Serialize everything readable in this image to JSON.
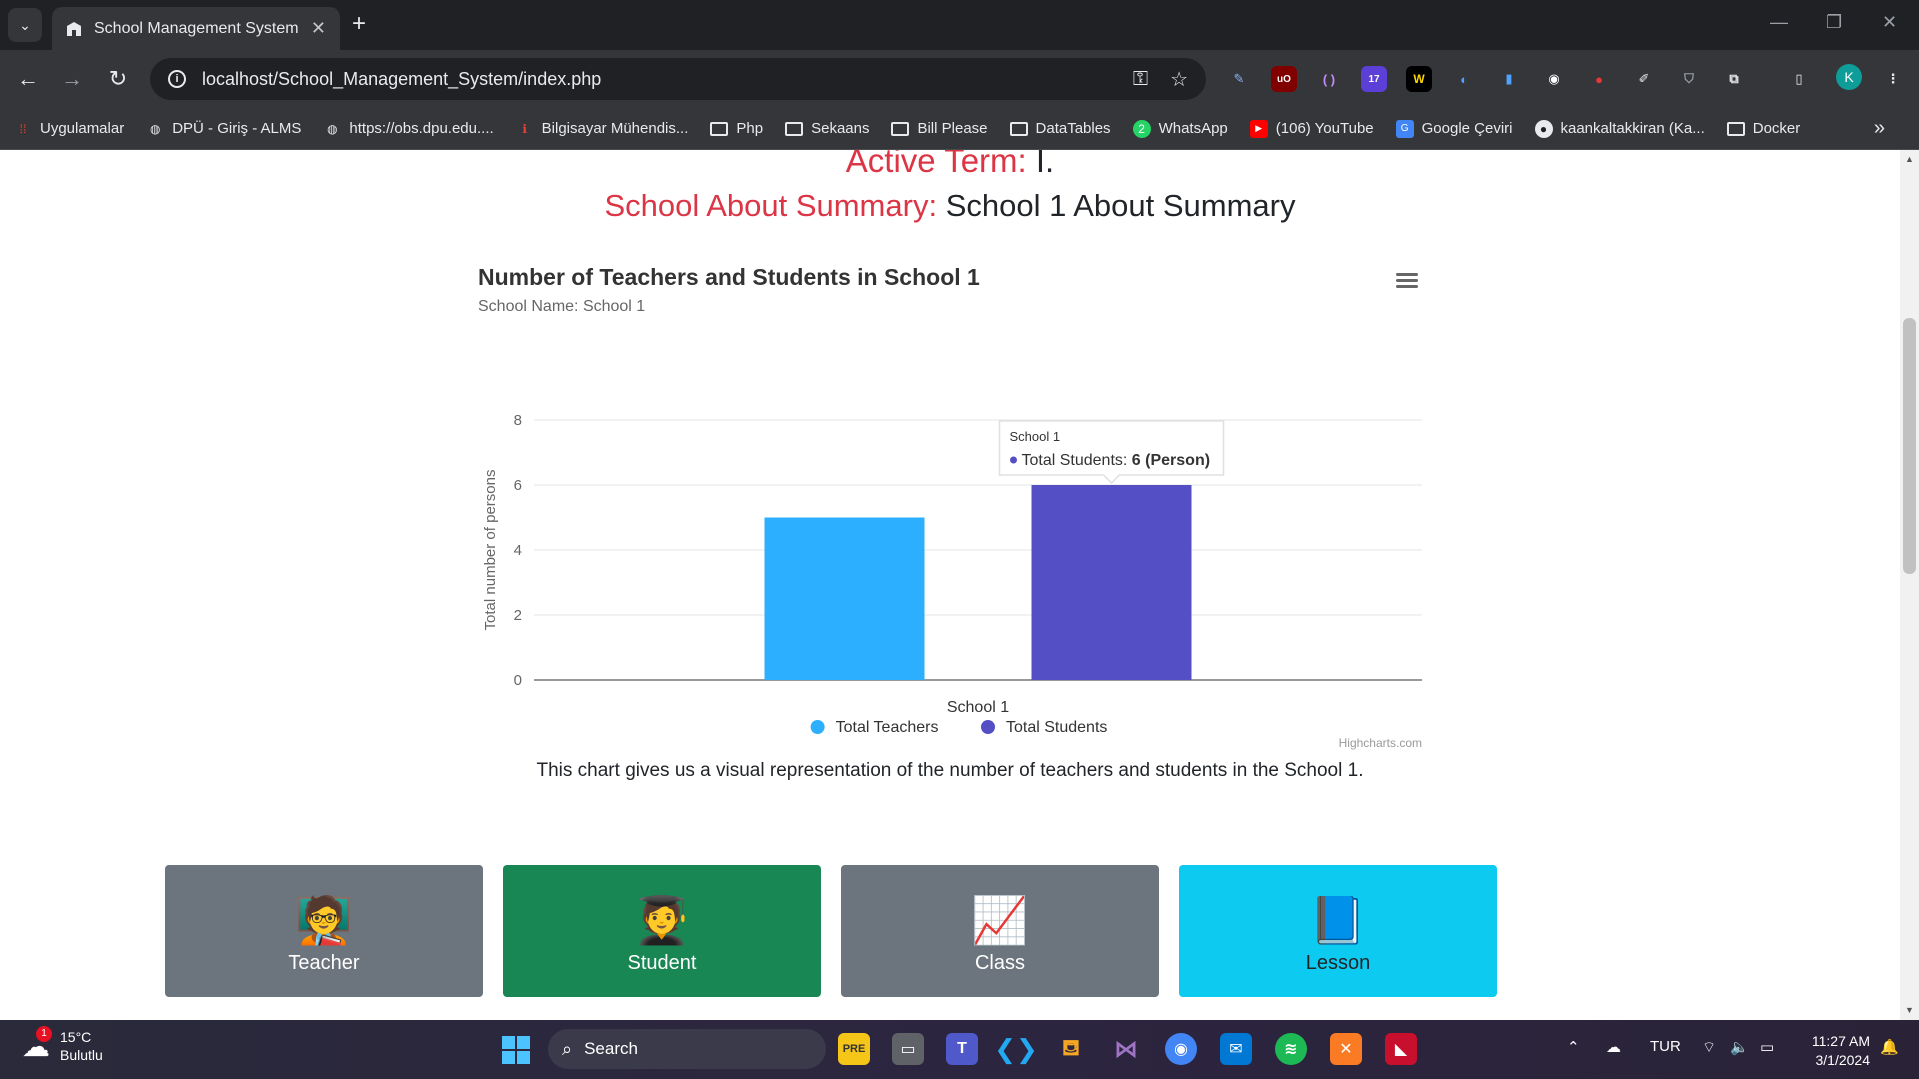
{
  "browser": {
    "tab_title": "School Management System",
    "url": "localhost/School_Management_System/index.php",
    "extension_badge": "17",
    "avatar_letter": "K",
    "bookmarks": [
      {
        "label": "Uygulamalar",
        "icon": "apps-grid-icon"
      },
      {
        "label": "DPÜ - Giriş - ALMS",
        "icon": "globe-icon"
      },
      {
        "label": "https://obs.dpu.edu....",
        "icon": "globe-icon"
      },
      {
        "label": "Bilgisayar Mühendis...",
        "icon": "info-icon"
      },
      {
        "label": "Php",
        "icon": "folder-icon"
      },
      {
        "label": "Sekaans",
        "icon": "folder-icon"
      },
      {
        "label": "Bill Please",
        "icon": "folder-icon"
      },
      {
        "label": "DataTables",
        "icon": "folder-icon"
      },
      {
        "label": "WhatsApp",
        "icon": "whatsapp-icon",
        "badge": "2"
      },
      {
        "label": "(106) YouTube",
        "icon": "youtube-icon"
      },
      {
        "label": "Google Çeviri",
        "icon": "translate-icon"
      },
      {
        "label": "kaankaltakkiran (Ka...",
        "icon": "github-icon"
      },
      {
        "label": "Docker",
        "icon": "folder-icon"
      }
    ]
  },
  "page": {
    "active_term_label": "Active Term:",
    "active_term_value": "I.",
    "about_label": "School About Summary:",
    "about_value": "School 1 About Summary",
    "caption": "This chart gives us a visual representation of the number of teachers and students in the School 1.",
    "cards": [
      {
        "label": "Teacher",
        "icon": "teacher-icon"
      },
      {
        "label": "Student",
        "icon": "student-icon"
      },
      {
        "label": "Class",
        "icon": "chalkboard-icon"
      },
      {
        "label": "Lesson",
        "icon": "book-icon"
      }
    ]
  },
  "chart_data": {
    "type": "bar",
    "title": "Number of Teachers and Students in School 1",
    "subtitle": "School Name: School 1",
    "categories": [
      "School 1"
    ],
    "series": [
      {
        "name": "Total Teachers",
        "values": [
          5
        ],
        "color": "#2caffe"
      },
      {
        "name": "Total Students",
        "values": [
          6
        ],
        "color": "#544fc5"
      }
    ],
    "ylabel": "Total number of persons",
    "xlabel": "",
    "ylim": [
      0,
      8
    ],
    "yticks": [
      0,
      2,
      4,
      6,
      8
    ],
    "grid": true,
    "legend_position": "bottom-center",
    "tooltip": {
      "header": "School 1",
      "series": "Total Students",
      "value": "6 (Person)"
    },
    "credits": "Highcharts.com"
  },
  "taskbar": {
    "weather_temp": "15°C",
    "weather_desc": "Bulutlu",
    "weather_badge": "1",
    "search_label": "Search",
    "language": "TUR",
    "time": "11:27 AM",
    "date": "3/1/2024"
  }
}
